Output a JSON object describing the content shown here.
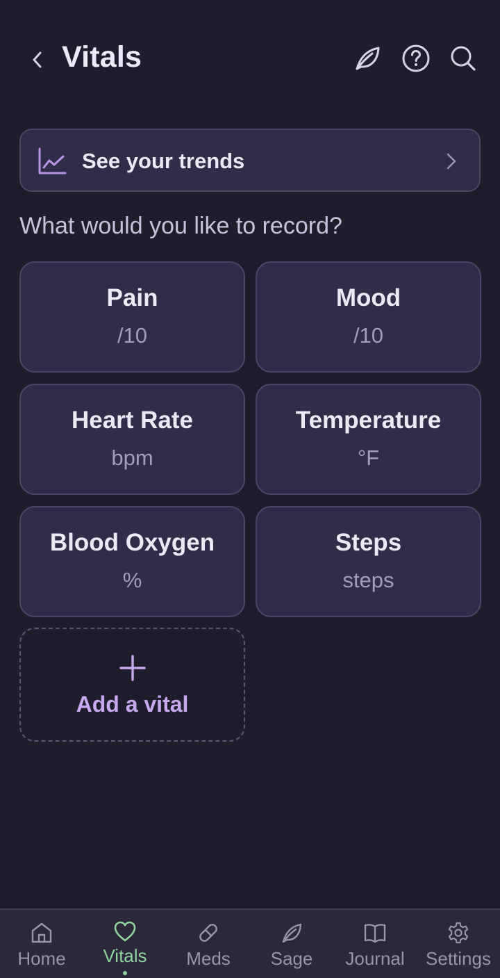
{
  "header": {
    "title": "Vitals",
    "back_icon": "chevron-left-icon",
    "actions": [
      "leaf-icon",
      "help-icon",
      "search-icon"
    ]
  },
  "trends": {
    "label": "See your trends",
    "icon": "line-chart-icon"
  },
  "prompt": "What would you like to record?",
  "vitals": [
    {
      "name": "Pain",
      "unit": "/10"
    },
    {
      "name": "Mood",
      "unit": "/10"
    },
    {
      "name": "Heart Rate",
      "unit": "bpm"
    },
    {
      "name": "Temperature",
      "unit": "°F"
    },
    {
      "name": "Blood Oxygen",
      "unit": "%"
    },
    {
      "name": "Steps",
      "unit": "steps"
    }
  ],
  "add_vital": {
    "label": "Add a vital"
  },
  "nav": [
    {
      "label": "Home",
      "icon": "home-icon"
    },
    {
      "label": "Vitals",
      "icon": "heart-icon",
      "active": true
    },
    {
      "label": "Meds",
      "icon": "pill-icon"
    },
    {
      "label": "Sage",
      "icon": "leaf-icon"
    },
    {
      "label": "Journal",
      "icon": "book-icon"
    },
    {
      "label": "Settings",
      "icon": "gear-icon"
    }
  ],
  "colors": {
    "background": "#1f1d2b",
    "card": "#312c47",
    "accent_purple": "#c8a8ef",
    "accent_green": "#8fd49e"
  }
}
